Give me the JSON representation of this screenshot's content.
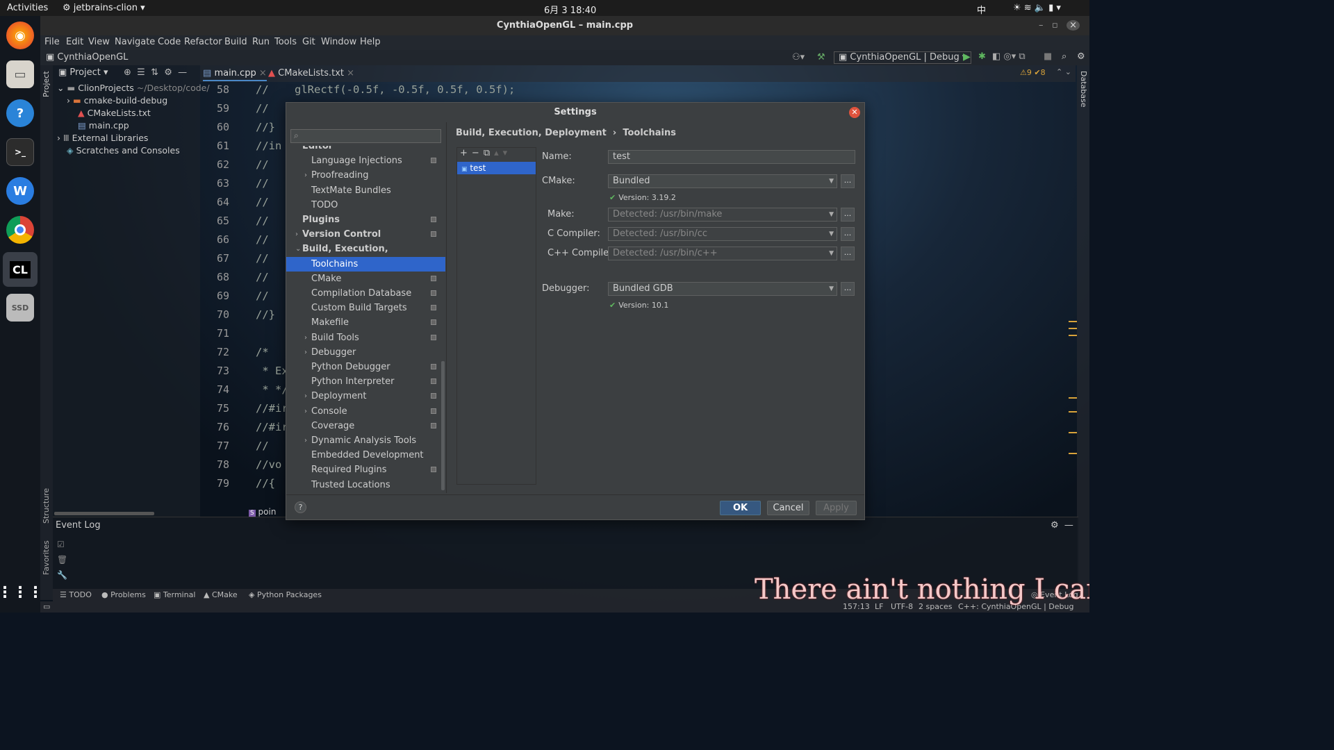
{
  "topbar": {
    "activities": "Activities",
    "app": "jetbrains-clion",
    "clock": "6月 3  18:40",
    "input_method": "中"
  },
  "window": {
    "title": "CynthiaOpenGL – main.cpp"
  },
  "menu": [
    "File",
    "Edit",
    "View",
    "Navigate",
    "Code",
    "Refactor",
    "Build",
    "Run",
    "Tools",
    "Git",
    "Window",
    "Help"
  ],
  "navbar": {
    "project": "CynthiaOpenGL",
    "run_config": "CynthiaOpenGL | Debug"
  },
  "project_panel": {
    "header": "Project",
    "items": [
      {
        "label": "ClionProjects",
        "extra": "~/Desktop/code/"
      },
      {
        "label": "cmake-build-debug"
      },
      {
        "label": "CMakeLists.txt"
      },
      {
        "label": "main.cpp"
      },
      {
        "label": "External Libraries"
      },
      {
        "label": "Scratches and Consoles"
      }
    ]
  },
  "tabs": [
    "main.cpp",
    "CMakeLists.txt"
  ],
  "editor": {
    "inspection": "⚠9 ✔8",
    "lines": [
      {
        "n": "58",
        "code": "//    glRectf(-0.5f, -0.5f, 0.5f, 0.5f);"
      },
      {
        "n": "59",
        "code": "//"
      },
      {
        "n": "60",
        "code": "//}"
      },
      {
        "n": "61",
        "code": "//in"
      },
      {
        "n": "62",
        "code": "//"
      },
      {
        "n": "63",
        "code": "//"
      },
      {
        "n": "64",
        "code": "//"
      },
      {
        "n": "65",
        "code": "//"
      },
      {
        "n": "66",
        "code": "//"
      },
      {
        "n": "67",
        "code": "//"
      },
      {
        "n": "68",
        "code": "//"
      },
      {
        "n": "69",
        "code": "//"
      },
      {
        "n": "70",
        "code": "//}"
      },
      {
        "n": "71",
        "code": ""
      },
      {
        "n": "72",
        "code": "/*"
      },
      {
        "n": "73",
        "code": " * Ex"
      },
      {
        "n": "74",
        "code": " * */"
      },
      {
        "n": "75",
        "code": "//#ir"
      },
      {
        "n": "76",
        "code": "//#ir"
      },
      {
        "n": "77",
        "code": "//"
      },
      {
        "n": "78",
        "code": "//vo"
      },
      {
        "n": "79",
        "code": "//{"
      }
    ],
    "breadcrumb": "poin"
  },
  "settings": {
    "title": "Settings",
    "search_placeholder": "",
    "breadcrumb": {
      "parent": "Build, Execution, Deployment",
      "sep": "›",
      "current": "Toolchains"
    },
    "nav": [
      {
        "label": "Editor",
        "bold": true,
        "level": 0,
        "arrow": "",
        "page": false
      },
      {
        "label": "Language Injections",
        "level": 1,
        "arrow": "",
        "page": true
      },
      {
        "label": "Proofreading",
        "level": 1,
        "arrow": "›",
        "page": false
      },
      {
        "label": "TextMate Bundles",
        "level": 1,
        "arrow": "",
        "page": false
      },
      {
        "label": "TODO",
        "level": 1,
        "arrow": "",
        "page": false
      },
      {
        "label": "Plugins",
        "bold": true,
        "level": 0,
        "arrow": "",
        "page": true
      },
      {
        "label": "Version Control",
        "bold": true,
        "level": 0,
        "arrow": "›",
        "page": true
      },
      {
        "label": "Build, Execution, Deployment",
        "bold": true,
        "level": 0,
        "arrow": "⌄",
        "page": false
      },
      {
        "label": "Toolchains",
        "level": 1,
        "arrow": "",
        "page": false,
        "selected": true
      },
      {
        "label": "CMake",
        "level": 1,
        "arrow": "",
        "page": true
      },
      {
        "label": "Compilation Database",
        "level": 1,
        "arrow": "",
        "page": true
      },
      {
        "label": "Custom Build Targets",
        "level": 1,
        "arrow": "",
        "page": true
      },
      {
        "label": "Makefile",
        "level": 1,
        "arrow": "",
        "page": true
      },
      {
        "label": "Build Tools",
        "level": 1,
        "arrow": "›",
        "page": true
      },
      {
        "label": "Debugger",
        "level": 1,
        "arrow": "›",
        "page": false
      },
      {
        "label": "Python Debugger",
        "level": 1,
        "arrow": "",
        "page": true
      },
      {
        "label": "Python Interpreter",
        "level": 1,
        "arrow": "",
        "page": true
      },
      {
        "label": "Deployment",
        "level": 1,
        "arrow": "›",
        "page": true
      },
      {
        "label": "Console",
        "level": 1,
        "arrow": "›",
        "page": true
      },
      {
        "label": "Coverage",
        "level": 1,
        "arrow": "",
        "page": true
      },
      {
        "label": "Dynamic Analysis Tools",
        "level": 1,
        "arrow": "›",
        "page": false
      },
      {
        "label": "Embedded Development",
        "level": 1,
        "arrow": "",
        "page": false
      },
      {
        "label": "Required Plugins",
        "level": 1,
        "arrow": "",
        "page": true
      },
      {
        "label": "Trusted Locations",
        "level": 1,
        "arrow": "",
        "page": false
      }
    ],
    "toolchains": [
      "test"
    ],
    "form": {
      "name_label": "Name:",
      "name_value": "test",
      "cmake_label": "CMake:",
      "cmake_value": "Bundled",
      "cmake_version": "Version: 3.19.2",
      "make_label": "Make:",
      "make_value": "Detected: /usr/bin/make",
      "cc_label": "C Compiler:",
      "cc_value": "Detected: /usr/bin/cc",
      "cxx_label": "C++ Compiler:",
      "cxx_value": "Detected: /usr/bin/c++",
      "debugger_label": "Debugger:",
      "debugger_value": "Bundled GDB",
      "debugger_version": "Version: 10.1",
      "browse": "..."
    },
    "buttons": {
      "help": "?",
      "ok": "OK",
      "cancel": "Cancel",
      "apply": "Apply"
    }
  },
  "eventlog": {
    "title": "Event Log"
  },
  "bottom_tools": [
    "TODO",
    "Problems",
    "Terminal",
    "CMake",
    "Python Packages"
  ],
  "status": {
    "position": "157:13",
    "line_sep": "LF",
    "encoding": "UTF-8",
    "indent": "2 spaces",
    "context": "C++: CynthiaOpenGL | Debug",
    "event_log": "Event Log"
  },
  "side_tabs": {
    "project": "Project",
    "structure": "Structure",
    "favorites": "Favorites",
    "database": "Database"
  },
  "overlay_lyric": "There ain't nothing I can d",
  "dock": {
    "ssd": "SSD",
    "clion": "CL"
  }
}
